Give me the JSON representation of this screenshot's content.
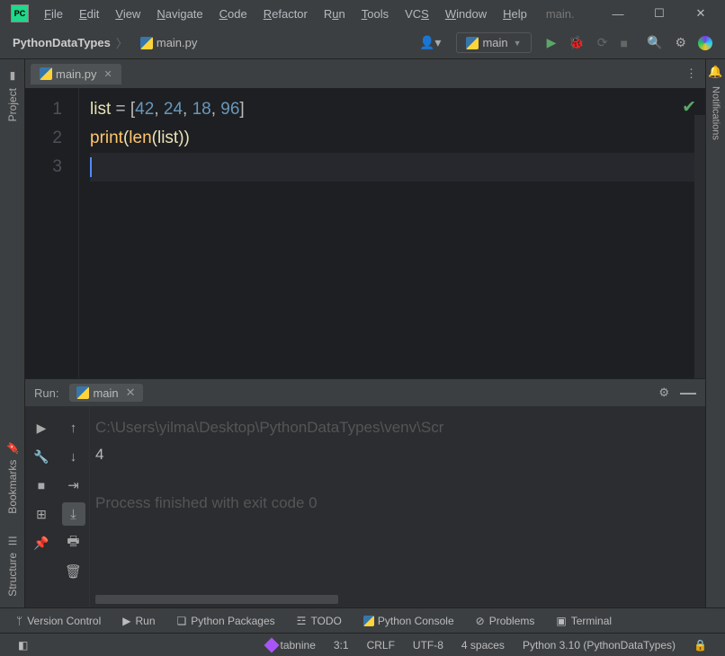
{
  "menu": {
    "file": "File",
    "edit": "Edit",
    "view": "View",
    "navigate": "Navigate",
    "code": "Code",
    "refactor": "Refactor",
    "run": "Run",
    "tools": "Tools",
    "vcs": "VCS",
    "window": "Window",
    "help": "Help"
  },
  "title_suffix": "main.",
  "breadcrumb": {
    "project": "PythonDataTypes",
    "file": "main.py"
  },
  "runconfig": "main",
  "tab": {
    "name": "main.py"
  },
  "code": {
    "lines": [
      "1",
      "2",
      "3"
    ],
    "l1": {
      "a": "list",
      "b": " = [",
      "n1": "42",
      "c": ", ",
      "n2": "24",
      "n3": "18",
      "n4": "96",
      "d": "]"
    },
    "l2": {
      "fn": "print",
      "p1": "(",
      "fn2": "len",
      "p2": "(",
      "id": "list",
      "p3": ")",
      ")": ")",
      "p4": ")"
    }
  },
  "runpanel": {
    "label": "Run:",
    "tab": "main",
    "path": "C:\\Users\\yilma\\Desktop\\PythonDataTypes\\venv\\Scr",
    "output": "4",
    "exit": "Process finished with exit code 0"
  },
  "left": {
    "project": "Project",
    "bookmarks": "Bookmarks",
    "structure": "Structure"
  },
  "right": {
    "notifications": "Notifications"
  },
  "bottom": {
    "vc": "Version Control",
    "run": "Run",
    "pkg": "Python Packages",
    "todo": "TODO",
    "pyconsole": "Python Console",
    "problems": "Problems",
    "terminal": "Terminal"
  },
  "status": {
    "tabnine": "tabnine",
    "pos": "3:1",
    "eol": "CRLF",
    "enc": "UTF-8",
    "indent": "4 spaces",
    "interpreter": "Python 3.10 (PythonDataTypes)"
  }
}
